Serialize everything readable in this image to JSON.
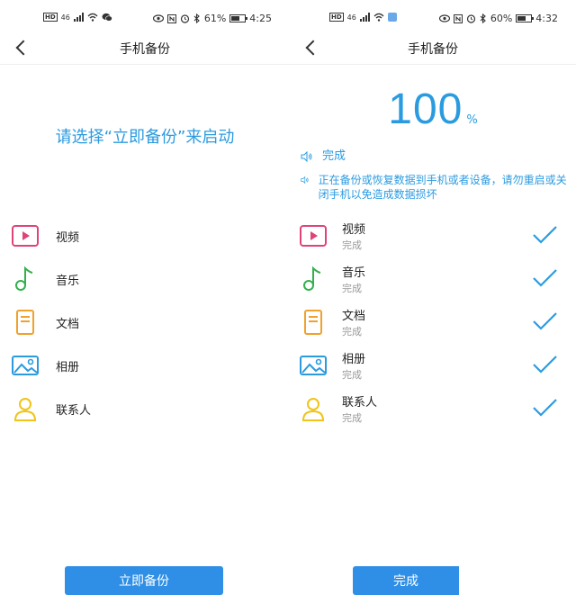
{
  "left": {
    "status_bar": {
      "hd": "HD",
      "signal": "46",
      "battery": "61%",
      "time": "4:25"
    },
    "header": {
      "title": "手机备份"
    },
    "prompt": "请选择“立即备份”来启动",
    "categories": [
      {
        "label": "视频",
        "icon": "video-icon"
      },
      {
        "label": "音乐",
        "icon": "music-icon"
      },
      {
        "label": "文档",
        "icon": "document-icon"
      },
      {
        "label": "相册",
        "icon": "album-icon"
      },
      {
        "label": "联系人",
        "icon": "contact-icon"
      }
    ],
    "button_label": "立即备份"
  },
  "right": {
    "status_bar": {
      "hd": "HD",
      "signal": "46",
      "battery": "60%",
      "time": "4:32"
    },
    "header": {
      "title": "手机备份"
    },
    "progress": {
      "value": "100",
      "unit": "%"
    },
    "status_lines": [
      "完成",
      "正在备份或恢复数据到手机或者设备，请勿重启或关闭手机以免造成数据损坏"
    ],
    "items": [
      {
        "name": "视频",
        "status": "完成",
        "icon": "video-icon"
      },
      {
        "name": "音乐",
        "status": "完成",
        "icon": "music-icon"
      },
      {
        "name": "文档",
        "status": "完成",
        "icon": "document-icon"
      },
      {
        "name": "相册",
        "status": "完成",
        "icon": "album-icon"
      },
      {
        "name": "联系人",
        "status": "完成",
        "icon": "contact-icon"
      }
    ],
    "button_label": "完成"
  },
  "colors": {
    "accent": "#2b9be0",
    "button": "#2f8fe6",
    "video": "#e0427a",
    "music": "#33b04d",
    "document": "#f0a12e",
    "album": "#2b9be0",
    "contact": "#f0c419"
  }
}
